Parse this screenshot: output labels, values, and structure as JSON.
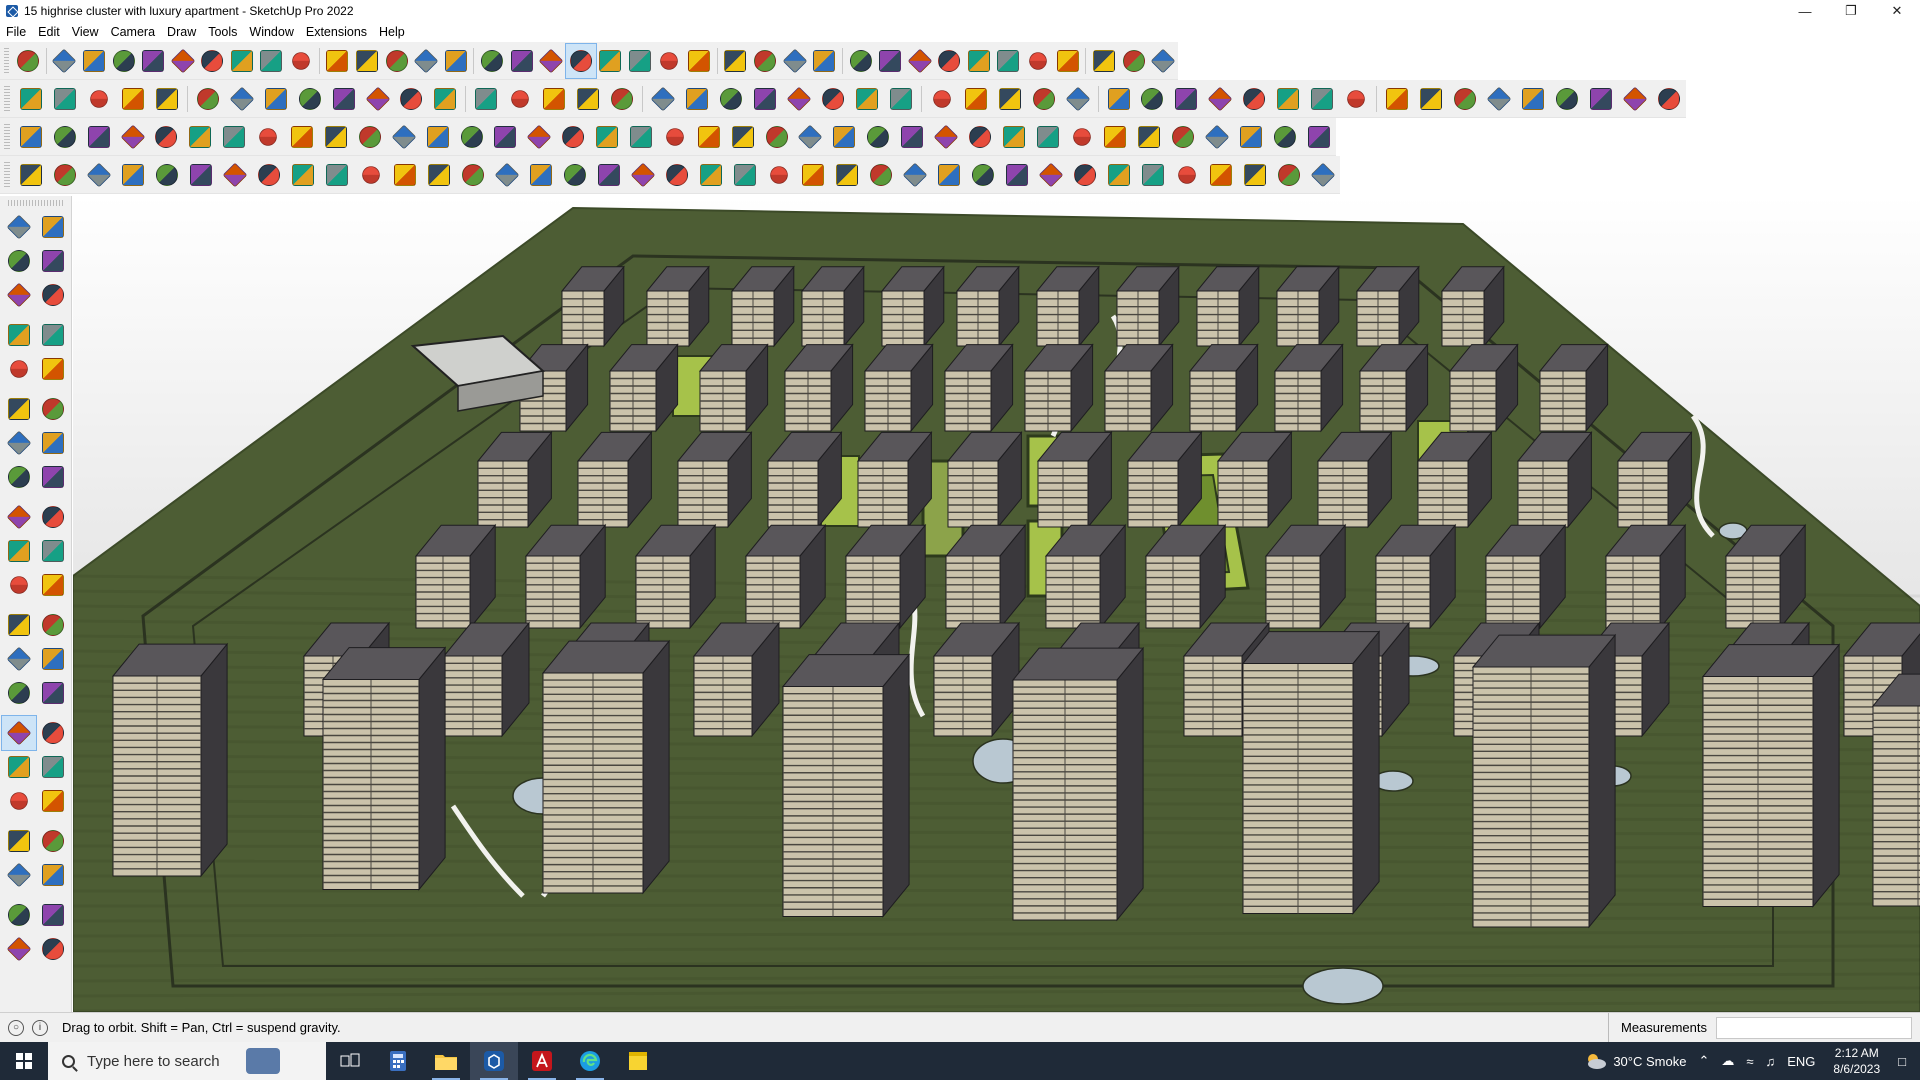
{
  "window": {
    "title": "15 highrise cluster with luxury apartment - SketchUp Pro 2022",
    "controls": [
      "—",
      "❐",
      "✕"
    ]
  },
  "menu": [
    "File",
    "Edit",
    "View",
    "Camera",
    "Draw",
    "Tools",
    "Window",
    "Extensions",
    "Help"
  ],
  "status": {
    "info_icon": "i",
    "message": "Drag to orbit. Shift = Pan, Ctrl = suspend gravity.",
    "measurements_label": "Measurements",
    "measurements_value": ""
  },
  "taskbar": {
    "search_placeholder": "Type here to search",
    "weather": "30°C  Smoke",
    "language": "ENG",
    "time": "2:12 AM",
    "date": "8/6/2023"
  },
  "colors": {
    "ground": "#4d5d34",
    "ground_edge": "#3c4a28",
    "building_roof": "#59565a",
    "building_wall": "#cbc3ab",
    "building_dark": "#3a383c",
    "lawn": "#a6c24a",
    "water": "#b9c8d2",
    "path": "#f2f2ee",
    "active_tool": "#cde4f7",
    "taskbar": "#1f2a38"
  }
}
